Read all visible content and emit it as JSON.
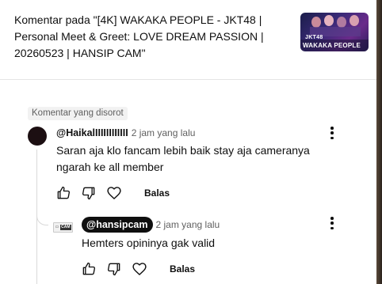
{
  "video": {
    "title": "Komentar pada \"[4K] WAKAKA PEOPLE - JKT48 | Personal Meet & Greet: LOVE DREAM PASSION | 20260523 | HANSIP CAM\"",
    "thumbnail_line1": "JKT48",
    "thumbnail_line2": "WAKAKA PEOPLE"
  },
  "pinned_label": "Komentar yang disorot",
  "comment": {
    "author": "@HaikalIIIIIIIIIIII",
    "time": "2 jam yang lalu",
    "text": "Saran aja klo fancam lebih baik stay aja cameranya ngarah ke all member",
    "reply_label": "Balas"
  },
  "reply": {
    "author": "@hansipcam",
    "time": "2 jam yang lalu",
    "text": "Hemters opininya gak valid",
    "reply_label": "Balas",
    "avatar_text": "CAM"
  },
  "icons": {
    "like": "thumbs-up-icon",
    "dislike": "thumbs-down-icon",
    "heart": "heart-icon",
    "more": "more-vert-icon"
  }
}
